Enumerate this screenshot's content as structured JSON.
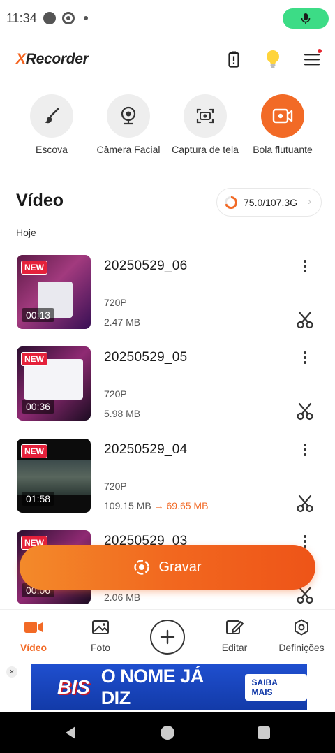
{
  "status_bar": {
    "time": "11:34"
  },
  "header": {
    "logo_x": "X",
    "logo_rest": "Recorder"
  },
  "tools": [
    {
      "label": "Escova",
      "icon": "brush-icon"
    },
    {
      "label": "Câmera Facial",
      "icon": "webcam-icon"
    },
    {
      "label": "Captura de tela",
      "icon": "screenshot-icon"
    },
    {
      "label": "Bola flutuante",
      "icon": "floating-recorder-icon"
    }
  ],
  "section": {
    "title": "Vídeo",
    "storage": "75.0/107.3G",
    "storage_used_fraction": 0.699,
    "date_group": "Hoje"
  },
  "videos": [
    {
      "title": "20250529_06",
      "badge": "NEW",
      "duration": "00:13",
      "resolution": "720P",
      "size": "2.47 MB"
    },
    {
      "title": "20250529_05",
      "badge": "NEW",
      "duration": "00:36",
      "resolution": "720P",
      "size": "5.98 MB"
    },
    {
      "title": "20250529_04",
      "badge": "NEW",
      "duration": "01:58",
      "resolution": "720P",
      "size": "109.15 MB",
      "size_arrow": "→",
      "compressed_size": "69.65 MB"
    },
    {
      "title": "20250529_03",
      "badge": "NEW",
      "duration": "00:06",
      "resolution": "",
      "size": "2.06 MB"
    }
  ],
  "record_button": {
    "label": "Gravar"
  },
  "bottom_nav": [
    {
      "label": "Vídeo",
      "active": true
    },
    {
      "label": "Foto",
      "active": false
    },
    {
      "label": "Editar",
      "active": false
    },
    {
      "label": "Definições",
      "active": false
    }
  ],
  "ad": {
    "brand": "BIS",
    "slogan": "O NOME JÁ DIZ",
    "cta": "SAIBA MAIS",
    "close": "×"
  },
  "colors": {
    "accent": "#f26a26",
    "mic_pill": "#3cdc86",
    "new_badge": "#e5213b",
    "ad_bg": "#1a45c4"
  }
}
